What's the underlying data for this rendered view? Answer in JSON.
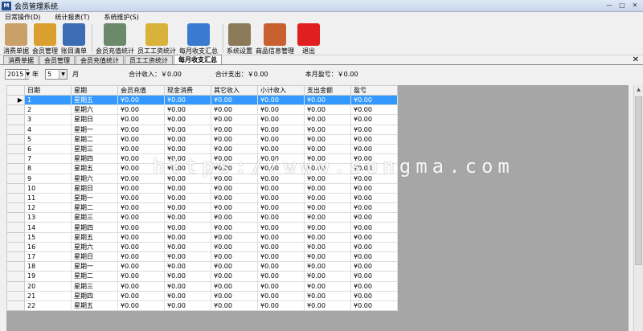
{
  "window": {
    "title": "会员管理系统",
    "icon_text": "M"
  },
  "menu": [
    "日常操作(D)",
    "统计报表(T)",
    "系统维护(S)"
  ],
  "toolbar": [
    {
      "label": "消费单据",
      "icon": "clipboard-icon",
      "color": "#c8a068"
    },
    {
      "label": "会员管理",
      "icon": "users-icon",
      "color": "#d9a030"
    },
    {
      "label": "账目清单",
      "icon": "list-icon",
      "color": "#3c6cb4"
    },
    {
      "label": "会员充值统计",
      "icon": "database-add-icon",
      "color": "#6a8a6a"
    },
    {
      "label": "员工工资统计",
      "icon": "bar-chart-icon",
      "color": "#d8b23a"
    },
    {
      "label": "每月收支汇总",
      "icon": "pie-chart-icon",
      "color": "#3a7ad0"
    },
    {
      "label": "系统设置",
      "icon": "tools-icon",
      "color": "#8a7a5a"
    },
    {
      "label": "商品信息管理",
      "icon": "grid-icon",
      "color": "#c86030"
    },
    {
      "label": "退出",
      "icon": "exit-icon",
      "color": "#e02020"
    }
  ],
  "tabs": [
    "消费单据",
    "会员管理",
    "会员充值统计",
    "员工工资统计",
    "每月收支汇总"
  ],
  "active_tab": 4,
  "filter": {
    "year_value": "2015",
    "year_label": "年",
    "month_value": "5",
    "month_label": "月",
    "total_income": "合计收入：￥0.00",
    "total_expense": "合计支出：￥0.00",
    "month_profit": "本月盈亏：￥0.00"
  },
  "table": {
    "columns": [
      "日期",
      "星期",
      "会员充值",
      "现金消费",
      "其它收入",
      "小计收入",
      "支出金额",
      "盈亏"
    ],
    "rows": [
      [
        "1",
        "星期五",
        "¥0.00",
        "¥0.00",
        "¥0.00",
        "¥0.00",
        "¥0.00",
        "¥0.00"
      ],
      [
        "2",
        "星期六",
        "¥0.00",
        "¥0.00",
        "¥0.00",
        "¥0.00",
        "¥0.00",
        "¥0.00"
      ],
      [
        "3",
        "星期日",
        "¥0.00",
        "¥0.00",
        "¥0.00",
        "¥0.00",
        "¥0.00",
        "¥0.00"
      ],
      [
        "4",
        "星期一",
        "¥0.00",
        "¥0.00",
        "¥0.00",
        "¥0.00",
        "¥0.00",
        "¥0.00"
      ],
      [
        "5",
        "星期二",
        "¥0.00",
        "¥0.00",
        "¥0.00",
        "¥0.00",
        "¥0.00",
        "¥0.00"
      ],
      [
        "6",
        "星期三",
        "¥0.00",
        "¥0.00",
        "¥0.00",
        "¥0.00",
        "¥0.00",
        "¥0.00"
      ],
      [
        "7",
        "星期四",
        "¥0.00",
        "¥0.00",
        "¥0.00",
        "¥0.00",
        "¥0.00",
        "¥0.00"
      ],
      [
        "8",
        "星期五",
        "¥0.00",
        "¥0.00",
        "¥0.00",
        "¥0.00",
        "¥0.00",
        "¥0.00"
      ],
      [
        "9",
        "星期六",
        "¥0.00",
        "¥0.00",
        "¥0.00",
        "¥0.00",
        "¥0.00",
        "¥0.00"
      ],
      [
        "10",
        "星期日",
        "¥0.00",
        "¥0.00",
        "¥0.00",
        "¥0.00",
        "¥0.00",
        "¥0.00"
      ],
      [
        "11",
        "星期一",
        "¥0.00",
        "¥0.00",
        "¥0.00",
        "¥0.00",
        "¥0.00",
        "¥0.00"
      ],
      [
        "12",
        "星期二",
        "¥0.00",
        "¥0.00",
        "¥0.00",
        "¥0.00",
        "¥0.00",
        "¥0.00"
      ],
      [
        "13",
        "星期三",
        "¥0.00",
        "¥0.00",
        "¥0.00",
        "¥0.00",
        "¥0.00",
        "¥0.00"
      ],
      [
        "14",
        "星期四",
        "¥0.00",
        "¥0.00",
        "¥0.00",
        "¥0.00",
        "¥0.00",
        "¥0.00"
      ],
      [
        "15",
        "星期五",
        "¥0.00",
        "¥0.00",
        "¥0.00",
        "¥0.00",
        "¥0.00",
        "¥0.00"
      ],
      [
        "16",
        "星期六",
        "¥0.00",
        "¥0.00",
        "¥0.00",
        "¥0.00",
        "¥0.00",
        "¥0.00"
      ],
      [
        "17",
        "星期日",
        "¥0.00",
        "¥0.00",
        "¥0.00",
        "¥0.00",
        "¥0.00",
        "¥0.00"
      ],
      [
        "18",
        "星期一",
        "¥0.00",
        "¥0.00",
        "¥0.00",
        "¥0.00",
        "¥0.00",
        "¥0.00"
      ],
      [
        "19",
        "星期二",
        "¥0.00",
        "¥0.00",
        "¥0.00",
        "¥0.00",
        "¥0.00",
        "¥0.00"
      ],
      [
        "20",
        "星期三",
        "¥0.00",
        "¥0.00",
        "¥0.00",
        "¥0.00",
        "¥0.00",
        "¥0.00"
      ],
      [
        "21",
        "星期四",
        "¥0.00",
        "¥0.00",
        "¥0.00",
        "¥0.00",
        "¥0.00",
        "¥0.00"
      ],
      [
        "22",
        "星期五",
        "¥0.00",
        "¥0.00",
        "¥0.00",
        "¥0.00",
        "¥0.00",
        "¥0.00"
      ]
    ],
    "selected_row": 0
  },
  "watermark": "https://www.songma.com"
}
